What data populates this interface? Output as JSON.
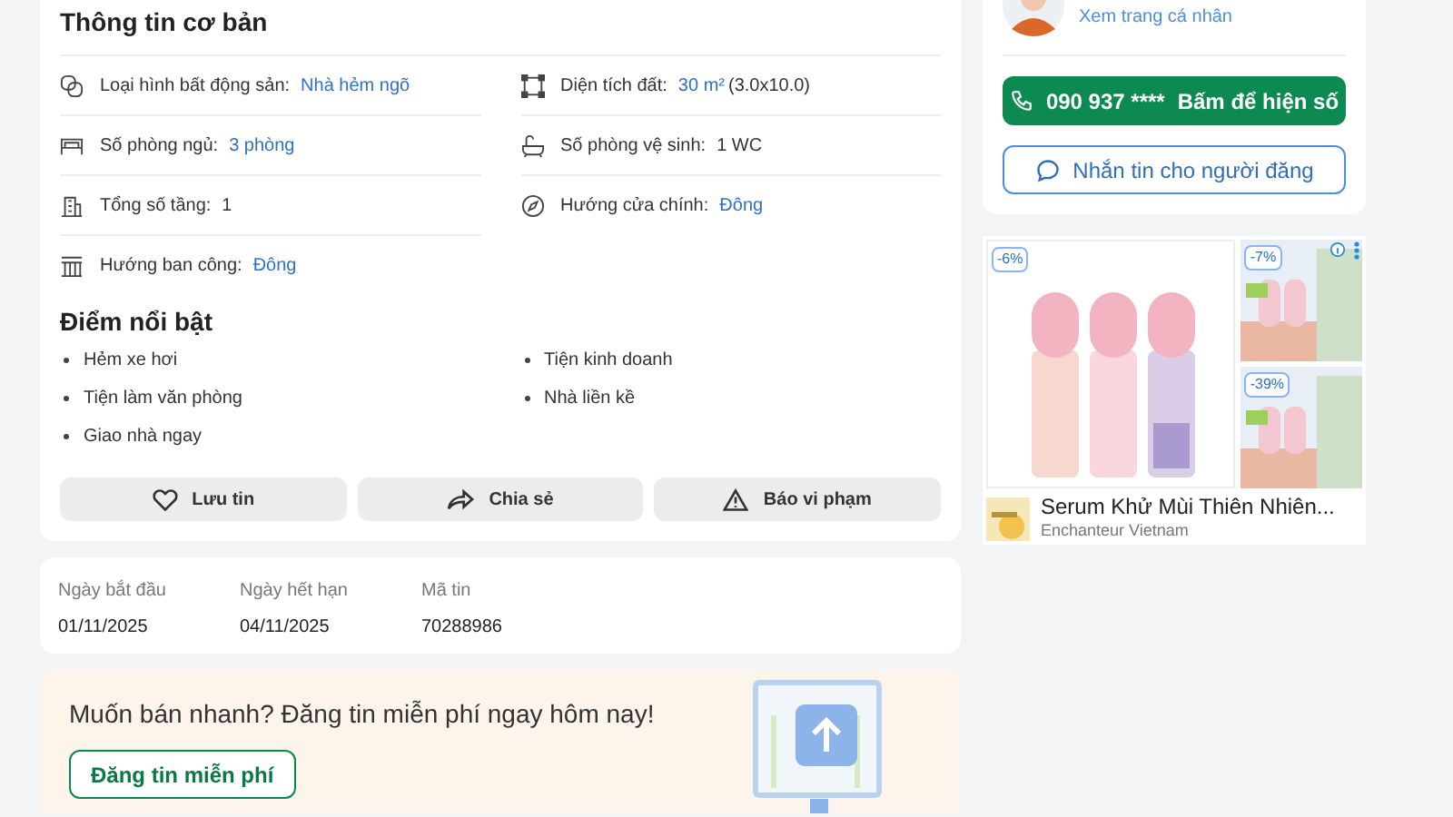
{
  "basic_info": {
    "title": "Thông tin cơ bản",
    "fields": [
      {
        "label": "Loại hình bất động sản:",
        "value": "Nhà hẻm ngõ",
        "highlighted": true
      },
      {
        "label": "Diện tích đất:",
        "value": "30 m²",
        "extra": "(3.0x10.0)",
        "highlighted": true
      },
      {
        "label": "Số phòng ngủ:",
        "value": "3 phòng",
        "highlighted": true
      },
      {
        "label": "Số phòng vệ sinh:",
        "value": "1 WC",
        "highlighted": false
      },
      {
        "label": "Tổng số tầng:",
        "value": "1",
        "highlighted": false
      },
      {
        "label": "Hướng cửa chính:",
        "value": "Đông",
        "highlighted": true
      },
      {
        "label": "Hướng ban công:",
        "value": "Đông",
        "highlighted": true
      }
    ]
  },
  "highlights": {
    "title": "Điểm nổi bật",
    "items": [
      "Hẻm xe hơi",
      "Tiện kinh doanh",
      "Tiện làm văn phòng",
      "Nhà liền kề",
      "Giao nhà ngay"
    ]
  },
  "actions": [
    "Lưu tin",
    "Chia sẻ",
    "Báo vi phạm"
  ],
  "listing_meta": [
    {
      "label": "Ngày bắt đầu",
      "value": "01/11/2025"
    },
    {
      "label": "Ngày hết hạn",
      "value": "04/11/2025"
    },
    {
      "label": "Mã tin",
      "value": "70288986"
    }
  ],
  "promo": {
    "text": "Muốn bán nhanh? Đăng tin miễn phí ngay hôm nay!",
    "button": "Đăng tin miễn phí"
  },
  "seller": {
    "profile_link": "Xem trang cá nhân",
    "phone_number": "090 937 ****",
    "phone_action": "Bấm để hiện số",
    "message_button": "Nhắn tin cho người đăng"
  },
  "ad": {
    "badges": [
      "-6%",
      "-7%",
      "-39%"
    ],
    "title": "Serum Khử Mùi Thiên Nhiên...",
    "advertiser": "Enchanteur Vietnam"
  }
}
